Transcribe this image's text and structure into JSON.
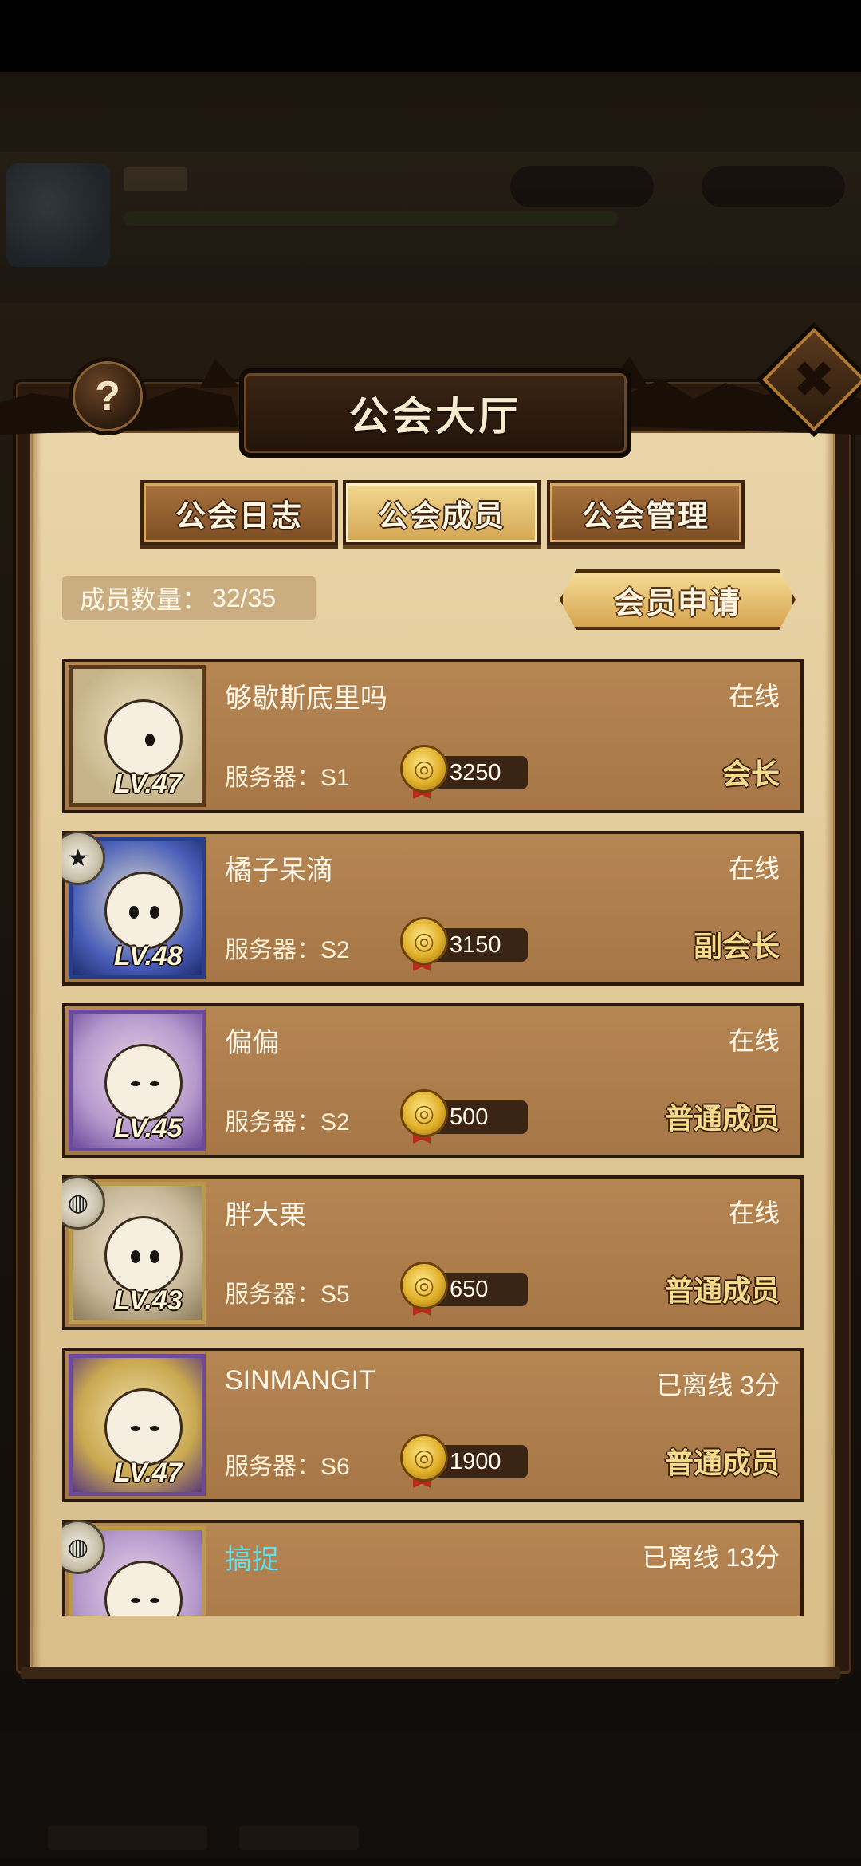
{
  "header": {
    "title": "公会大厅",
    "help_label": "?",
    "close_label": "✖"
  },
  "tabs": [
    {
      "label": "公会日志",
      "active": false
    },
    {
      "label": "公会成员",
      "active": true
    },
    {
      "label": "公会管理",
      "active": false
    }
  ],
  "member_count": {
    "label": "成员数量：",
    "value": "32/35"
  },
  "apply_button": "会员申请",
  "members": [
    {
      "name": "够歇斯底里吗",
      "status": "在线",
      "server": "服务器：S1",
      "coins": "3250",
      "role": "会长",
      "level": "LV.47"
    },
    {
      "name": "橘子呆滴",
      "status": "在线",
      "server": "服务器：S2",
      "coins": "3150",
      "role": "副会长",
      "level": "LV.48"
    },
    {
      "name": "偏偏",
      "status": "在线",
      "server": "服务器：S2",
      "coins": "500",
      "role": "普通成员",
      "level": "LV.45"
    },
    {
      "name": "胖大栗",
      "status": "在线",
      "server": "服务器：S5",
      "coins": "650",
      "role": "普通成员",
      "level": "LV.43"
    },
    {
      "name": "SINMANGIT",
      "status": "已离线 3分",
      "server": "服务器：S6",
      "coins": "1900",
      "role": "普通成员",
      "level": "LV.47"
    },
    {
      "name": "搞捉",
      "status": "已离线 13分",
      "server": "",
      "coins": "",
      "role": "",
      "level": ""
    }
  ],
  "colors": {
    "paper": "#e3cc9c",
    "row_bg": "#b58552",
    "role_gold": "#f6dc8a",
    "highlight_name": "#5fe0f0"
  }
}
